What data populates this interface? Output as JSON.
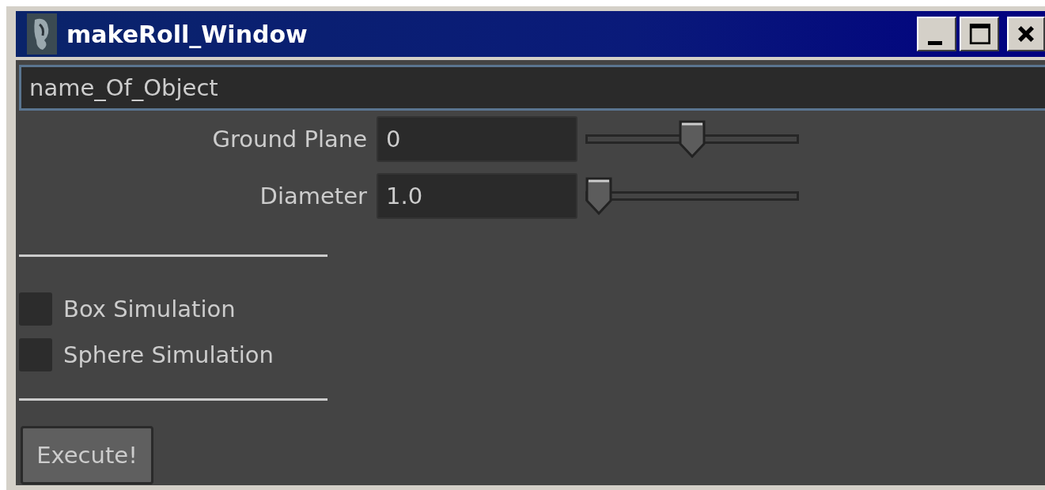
{
  "window": {
    "title": "makeRoll_Window"
  },
  "object_field": {
    "value": "name_Of_Object"
  },
  "sliders": [
    {
      "label": "Ground Plane",
      "value": "0",
      "level": 0.5
    },
    {
      "label": "Diameter",
      "value": "1.0",
      "level": 0
    }
  ],
  "checkboxes": [
    {
      "label": "Box Simulation",
      "checked": false
    },
    {
      "label": "Sphere Simulation",
      "checked": false
    }
  ],
  "buttons": [
    "Execute!"
  ]
}
